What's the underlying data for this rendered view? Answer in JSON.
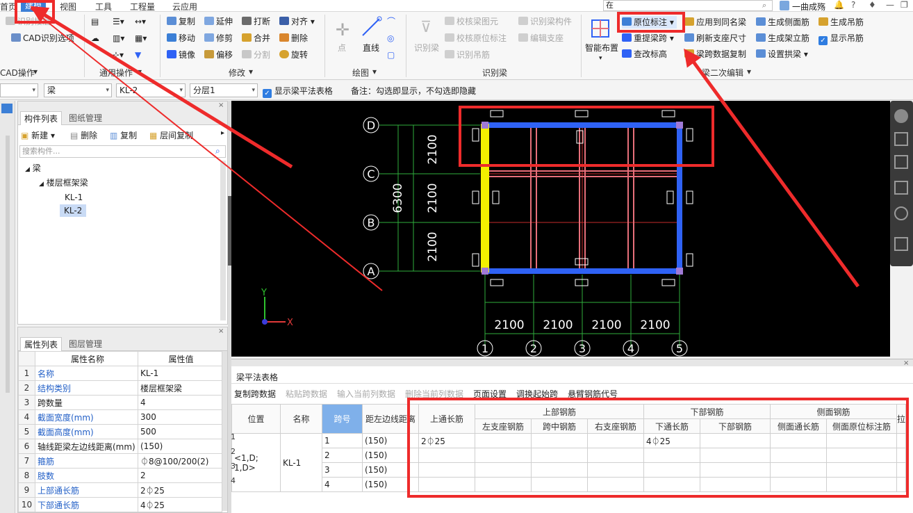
{
  "menu": {
    "items": [
      "首页",
      "建模",
      "视图",
      "工具",
      "工程量",
      "云应用"
    ],
    "active": "建模"
  },
  "search": {
    "value": "在"
  },
  "user": {
    "name": "一曲成殇"
  },
  "ribbon": {
    "cad_group": {
      "items": [
        "识别楼层",
        "CAD识别选项"
      ],
      "label": "CAD操作"
    },
    "general_group": {
      "label": "通用操作"
    },
    "modify_group": {
      "items": [
        "复制",
        "延伸",
        "打断",
        "对齐",
        "移动",
        "修剪",
        "合并",
        "删除",
        "镜像",
        "偏移",
        "分割",
        "旋转"
      ],
      "label": "修改"
    },
    "draw_group": {
      "items": [
        "点",
        "直线"
      ],
      "label": "绘图"
    },
    "recognize_group": {
      "items": [
        "识别梁",
        "校核梁图元",
        "识别梁构件",
        "校核原位标注",
        "编辑支座",
        "识别吊筋"
      ],
      "label": "识别梁"
    },
    "beam2_group": {
      "items": [
        "智能布置",
        "原位标注",
        "重提梁跨",
        "查改标高",
        "应用到同名梁",
        "刷新支座尺寸",
        "梁跨数据复制",
        "生成侧面筋",
        "生成架立筋",
        "设置拱梁",
        "生成吊筋",
        "显示吊筋"
      ],
      "label": "梁二次编辑"
    }
  },
  "propbar": {
    "sel1": "",
    "sel2": "梁",
    "sel3": "KL-2",
    "sel4": "分层1",
    "show_table": "显示梁平法表格",
    "note": "备注：勾选即显示，不勾选即隐藏"
  },
  "component_panel": {
    "tabs": [
      "构件列表",
      "图纸管理"
    ],
    "toolbar": [
      "新建",
      "删除",
      "复制",
      "层间复制"
    ],
    "search_placeholder": "搜索构件...",
    "tree": {
      "root": "梁",
      "group": "楼层框架梁",
      "items": [
        "KL-1",
        "KL-2"
      ],
      "selected": "KL-2"
    }
  },
  "prop_panel": {
    "tabs": [
      "属性列表",
      "图层管理"
    ],
    "headers": [
      "属性名称",
      "属性值"
    ],
    "rows": [
      {
        "n": "1",
        "name": "名称",
        "value": "KL-1",
        "blue": true
      },
      {
        "n": "2",
        "name": "结构类别",
        "value": "楼层框架梁",
        "blue": true
      },
      {
        "n": "3",
        "name": "跨数量",
        "value": "4",
        "blue": false
      },
      {
        "n": "4",
        "name": "截面宽度(mm)",
        "value": "300",
        "blue": true
      },
      {
        "n": "5",
        "name": "截面高度(mm)",
        "value": "500",
        "blue": true
      },
      {
        "n": "6",
        "name": "轴线距梁左边线距离(mm)",
        "value": "(150)",
        "blue": false
      },
      {
        "n": "7",
        "name": "箍筋",
        "value": "⏀8@100/200(2)",
        "blue": true
      },
      {
        "n": "8",
        "name": "肢数",
        "value": "2",
        "blue": true
      },
      {
        "n": "9",
        "name": "上部通长筋",
        "value": "2⏀25",
        "blue": true
      },
      {
        "n": "10",
        "name": "下部通长筋",
        "value": "4⏀25",
        "blue": true
      }
    ]
  },
  "drawing": {
    "axes_letters": [
      "D",
      "C",
      "B",
      "A"
    ],
    "axes_numbers": [
      "1",
      "2",
      "3",
      "4",
      "5"
    ],
    "v_dims": [
      "2100",
      "2100",
      "2100"
    ],
    "v_total": "6300",
    "h_dims": [
      "2100",
      "2100",
      "2100",
      "2100"
    ],
    "axis_x": "X",
    "axis_y": "Y"
  },
  "beam_table": {
    "title": "梁平法表格",
    "toolbar": [
      {
        "label": "复制跨数据",
        "enabled": true
      },
      {
        "label": "粘贴跨数据",
        "enabled": false
      },
      {
        "label": "输入当前列数据",
        "enabled": false
      },
      {
        "label": "删除当前列数据",
        "enabled": false
      },
      {
        "label": "页面设置",
        "enabled": true
      },
      {
        "label": "调换起始跨",
        "enabled": true
      },
      {
        "label": "悬臂钢筋代号",
        "enabled": true
      }
    ],
    "h_position": "位置",
    "h_name": "名称",
    "h_span": "跨号",
    "h_axis": "距左边线距离",
    "h_top_through": "上通长筋",
    "h_upper": "上部钢筋",
    "h_lower": "下部钢筋",
    "h_side": "侧面钢筋",
    "h_left_seat": "左支座钢筋",
    "h_mid": "跨中钢筋",
    "h_right_seat": "右支座钢筋",
    "h_bottom_through": "下通长筋",
    "h_bottom": "下部钢筋",
    "h_side_through": "侧面通长筋",
    "h_side_orig": "侧面原位标注筋",
    "h_extra": "拉",
    "position": "<1,D;\n1,D>",
    "name": "KL-1",
    "rows": [
      {
        "n": "1",
        "span": "1",
        "dist": "(150)",
        "top": "2⏀25",
        "bottom": "4⏀25"
      },
      {
        "n": "2",
        "span": "2",
        "dist": "(150)",
        "top": "",
        "bottom": ""
      },
      {
        "n": "3",
        "span": "3",
        "dist": "(150)",
        "top": "",
        "bottom": ""
      },
      {
        "n": "4",
        "span": "4",
        "dist": "(150)",
        "top": "",
        "bottom": ""
      }
    ]
  },
  "colors": {
    "accent": "#3c7fd6",
    "annotation": "#ee2b2b",
    "beam_blue": "#2f62f5",
    "beam_pink": "#e76f7a",
    "selected_beam": "#f3f000",
    "dim_green": "#2fae3d"
  }
}
